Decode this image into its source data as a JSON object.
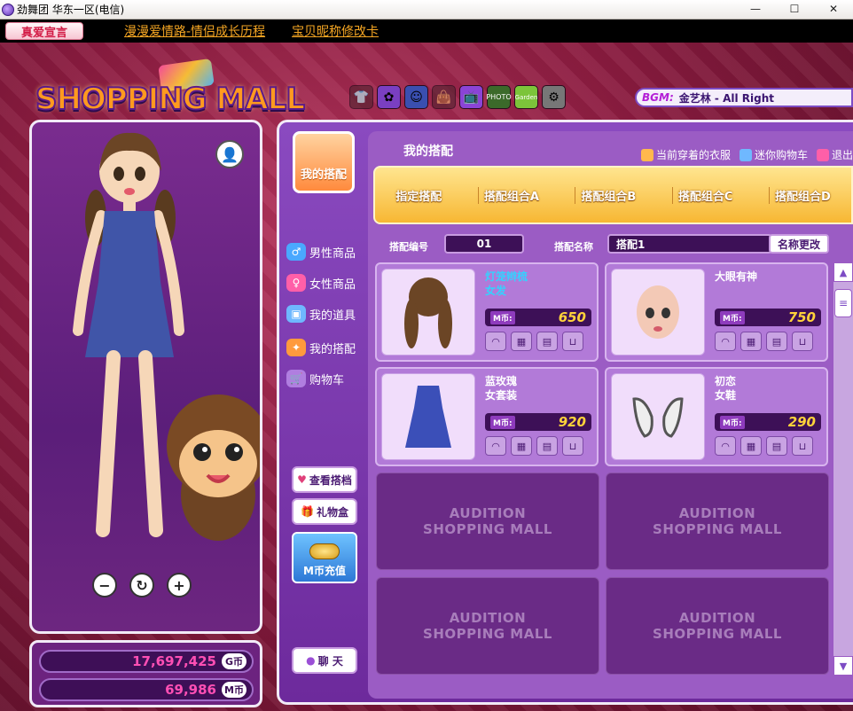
{
  "window": {
    "title": "劲舞团 华东一区(电信)",
    "controls": [
      "—",
      "☐",
      "✕"
    ]
  },
  "linkbar": {
    "vow_button": "真爱宣言",
    "links": [
      "漫漫爱情路-情侣成长历程",
      "宝贝昵称修改卡"
    ]
  },
  "logo": {
    "text": "SHOPPING MALL"
  },
  "bgm": {
    "tag": "BGM:",
    "track": "金艺林 - All Right"
  },
  "toolbar": {
    "icons": [
      "shirt-icon",
      "hair-icon",
      "face-icon",
      "bag-icon",
      "tv-icon",
      "photo-icon",
      "garden-icon",
      "settings-icon"
    ]
  },
  "character": {
    "zoom_out": "−",
    "rotate": "↻",
    "zoom_in": "+"
  },
  "currency": {
    "g_amount": "17,697,425",
    "g_unit": "G币",
    "m_amount": "69,986",
    "m_unit": "M币"
  },
  "sidebar": {
    "category_badge": "我的搭配",
    "items": [
      {
        "label": "男性商品",
        "color": "#4aa8ff"
      },
      {
        "label": "女性商品",
        "color": "#ff5fa8"
      },
      {
        "label": "我的道具",
        "color": "#6fb8ff"
      },
      {
        "label": "我的搭配",
        "color": "#ff9a3d"
      },
      {
        "label": "购物车",
        "color": "#b07ee0"
      }
    ],
    "view_button": "查看搭档",
    "gift_button": "礼物盒",
    "charge_button": "M币充值",
    "chat_button": "聊 天"
  },
  "main": {
    "title": "我的搭配",
    "header_links": [
      "当前穿着的衣服",
      "迷你购物车",
      "退出"
    ],
    "tabs": [
      "指定搭配",
      "搭配组合A",
      "搭配组合B",
      "搭配组合C",
      "搭配组合D"
    ],
    "outfit_number_label": "搭配编号",
    "outfit_number": "01",
    "outfit_name_label": "搭配名称",
    "outfit_name": "搭配1",
    "rename_button": "名称更改",
    "price_unit": "M币:",
    "items": [
      {
        "name_line1": "灯笼辫梳",
        "name_line2": "女发",
        "price": "650",
        "highlight": true
      },
      {
        "name_line1": "大眼有神",
        "name_line2": "",
        "price": "750",
        "highlight": false
      },
      {
        "name_line1": "蓝玫瑰",
        "name_line2": "女套装",
        "price": "920",
        "highlight": false
      },
      {
        "name_line1": "初恋",
        "name_line2": "女鞋",
        "price": "290",
        "highlight": false
      }
    ],
    "empty_slot_line1": "AUDITION",
    "empty_slot_line2": "SHOPPING MALL"
  }
}
